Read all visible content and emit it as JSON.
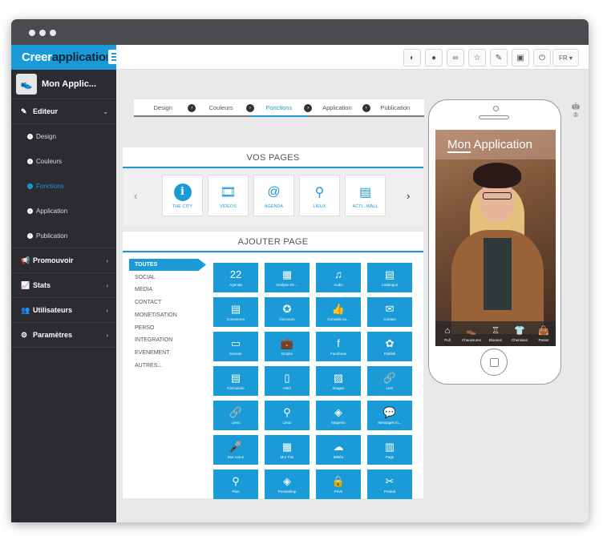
{
  "brand": {
    "part1": "Creer",
    "part2": "application"
  },
  "toolbar": {
    "icons": [
      "dashboard-icon",
      "user-icon",
      "binoculars-icon",
      "star-icon",
      "pen-icon",
      "camera-icon",
      "power-icon"
    ],
    "language": "FR ▾"
  },
  "sidebar": {
    "app_name": "Mon Applic...",
    "editor": {
      "label": "Editeur",
      "items": [
        {
          "label": "Design",
          "active": false
        },
        {
          "label": "Couleurs",
          "active": false
        },
        {
          "label": "Fonctions",
          "active": true
        },
        {
          "label": "Application",
          "active": false
        },
        {
          "label": "Publication",
          "active": false
        }
      ]
    },
    "menu": [
      {
        "label": "Promouvoir",
        "icon": "megaphone-icon"
      },
      {
        "label": "Stats",
        "icon": "chart-icon"
      },
      {
        "label": "Utilisateurs",
        "icon": "users-icon"
      },
      {
        "label": "Paramètres",
        "icon": "gears-icon"
      }
    ]
  },
  "steps": [
    {
      "label": "Design",
      "active": false
    },
    {
      "label": "Couleurs",
      "active": false
    },
    {
      "label": "Fonctions",
      "active": true
    },
    {
      "label": "Application",
      "active": false
    },
    {
      "label": "Publication",
      "active": false
    }
  ],
  "vos_pages": {
    "title": "VOS PAGES",
    "pages": [
      {
        "label": "THE CITY",
        "icon": "info-icon"
      },
      {
        "label": "VIDEOS",
        "icon": "film-icon"
      },
      {
        "label": "AGENDA",
        "icon": "calendar-at-icon"
      },
      {
        "label": "LIEUX",
        "icon": "map-pins-icon"
      },
      {
        "label": "ACTI...WALL",
        "icon": "newspaper-icon"
      }
    ]
  },
  "ajouter_page": {
    "title": "AJOUTER PAGE",
    "categories": [
      "TOUTES",
      "SOCIAL",
      "MEDIA",
      "CONTACT",
      "MONETISATION",
      "PERSO",
      "INTEGRATION",
      "EVENEMENT",
      "AUTRES..."
    ],
    "tiles": [
      {
        "label": "Agenda",
        "glyph": "22"
      },
      {
        "label": "Analyse De ...",
        "glyph": "▦"
      },
      {
        "label": "Audio",
        "glyph": "♫"
      },
      {
        "label": "Catalogue",
        "glyph": "▤"
      },
      {
        "label": "Commerce",
        "glyph": "▤"
      },
      {
        "label": "Concours",
        "glyph": "✪"
      },
      {
        "label": "Conseils ca...",
        "glyph": "👍"
      },
      {
        "label": "Contact",
        "glyph": "✉"
      },
      {
        "label": "Dossier",
        "glyph": "▭"
      },
      {
        "label": "Emploi",
        "glyph": "💼"
      },
      {
        "label": "Facebook",
        "glyph": "f"
      },
      {
        "label": "Fidélité",
        "glyph": "✿"
      },
      {
        "label": "Formulaire",
        "glyph": "▤"
      },
      {
        "label": "Html",
        "glyph": "▯"
      },
      {
        "label": "Images",
        "glyph": "▨"
      },
      {
        "label": "Lien",
        "glyph": "🔗"
      },
      {
        "label": "Liens",
        "glyph": "🔗"
      },
      {
        "label": "Lieux",
        "glyph": "⚲"
      },
      {
        "label": "Magento",
        "glyph": "◈"
      },
      {
        "label": "Messages In...",
        "glyph": "💬"
      },
      {
        "label": "Mur Actus",
        "glyph": "🎤"
      },
      {
        "label": "Mur Fan",
        "glyph": "▦"
      },
      {
        "label": "Météo",
        "glyph": "☁"
      },
      {
        "label": "Page",
        "glyph": "▥"
      },
      {
        "label": "Plan",
        "glyph": "⚲"
      },
      {
        "label": "Prestashop",
        "glyph": "◈"
      },
      {
        "label": "Privé",
        "glyph": "🔒"
      },
      {
        "label": "Produit",
        "glyph": "✂"
      }
    ]
  },
  "preview": {
    "app_title_part1": "Mon",
    "app_title_part2": " Application",
    "tabs": [
      {
        "label": "Pull",
        "icon": "sweater-icon"
      },
      {
        "label": "Chaussures",
        "icon": "shoe-icon"
      },
      {
        "label": "Blouson",
        "icon": "jacket-icon"
      },
      {
        "label": "Chemises",
        "icon": "shirt-icon"
      },
      {
        "label": "Panier",
        "icon": "bag-icon"
      }
    ]
  },
  "os_icons": [
    "apple-icon",
    "apple-icon",
    "android-icon",
    "html5-icon"
  ],
  "colors": {
    "accent": "#1a9ad6",
    "sidebar": "#2b2b30",
    "titlebar": "#4a4a4f"
  }
}
